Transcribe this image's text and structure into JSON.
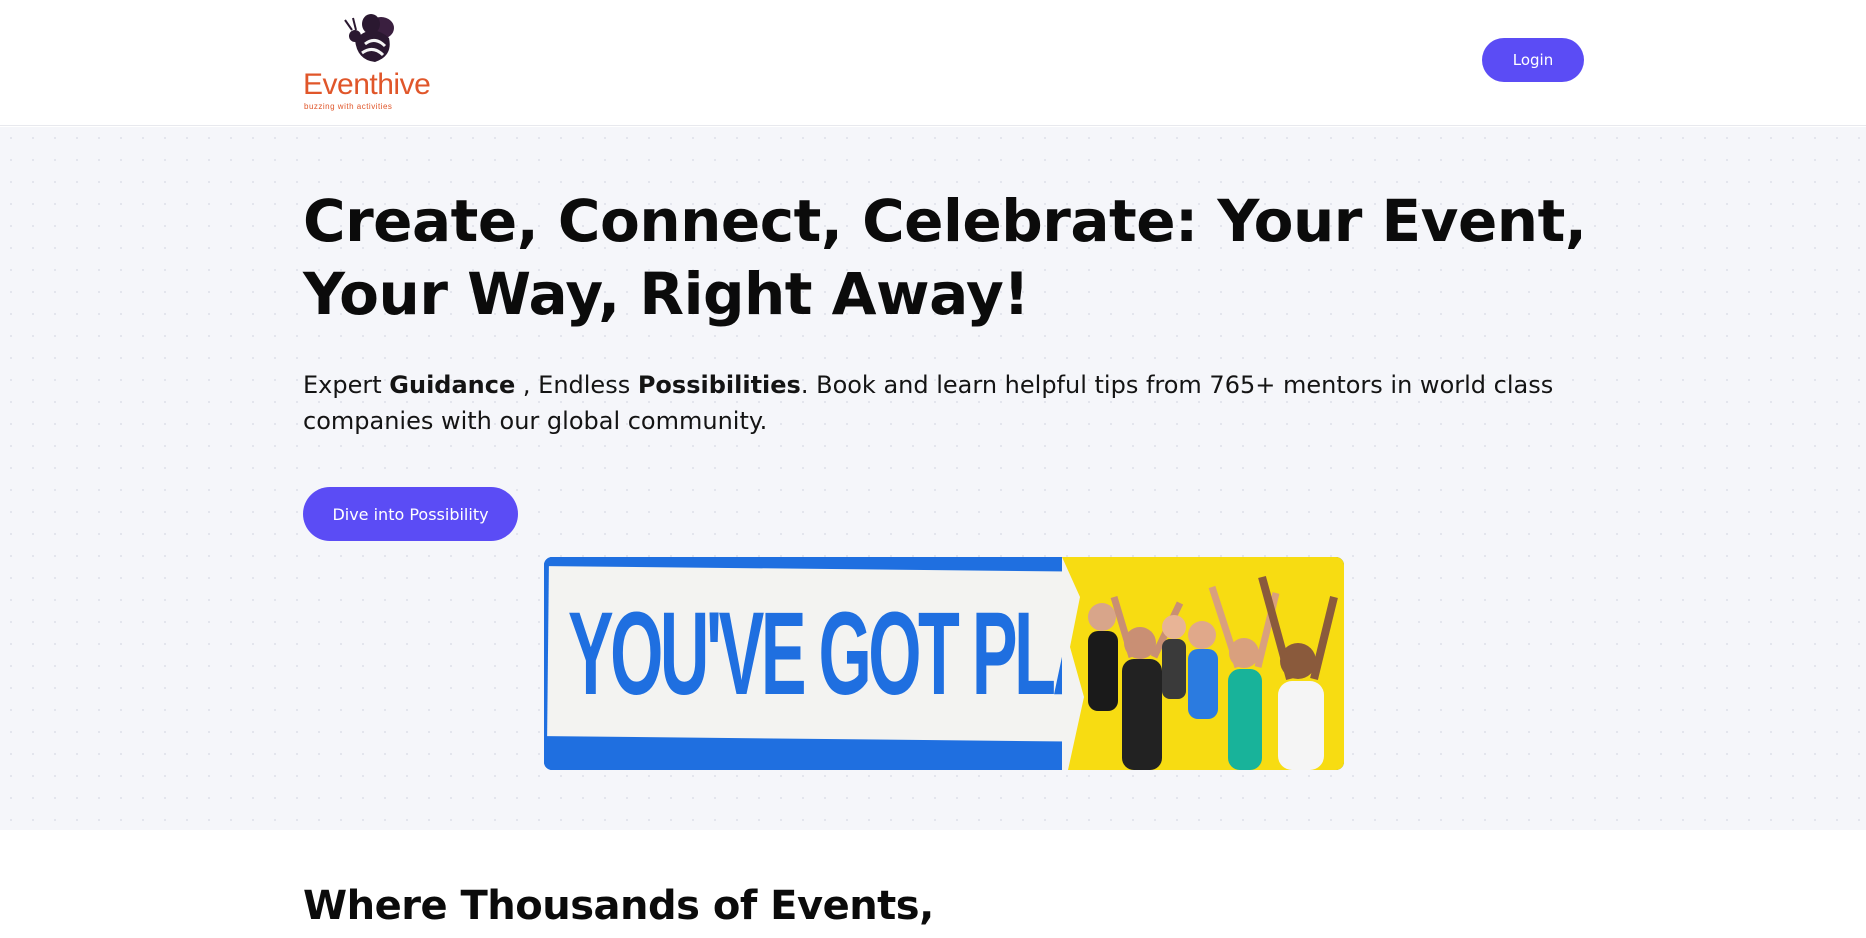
{
  "header": {
    "logo_name": "Eventhive",
    "logo_tagline": "buzzing with activities",
    "login_label": "Login"
  },
  "hero": {
    "title_line1": "Create, Connect, Celebrate: Your Event,",
    "title_line2": "Your Way, Right Away!",
    "sub_part1": "Expert ",
    "sub_bold1": "Guidance",
    "sub_part2": " , Endless ",
    "sub_bold2": "Possibilities",
    "sub_part3": ". Book and learn helpful tips from 765+ mentors in world class companies with our global community.",
    "cta_label": "Dive into Possibility",
    "banner_text": "YOU'VE GOT PLANS"
  },
  "section": {
    "title": "Where Thousands of Events,"
  },
  "colors": {
    "accent": "#5b4cf5",
    "brand_orange": "#e0562a",
    "banner_blue": "#1f6fe0",
    "banner_yellow": "#f7dc12"
  }
}
